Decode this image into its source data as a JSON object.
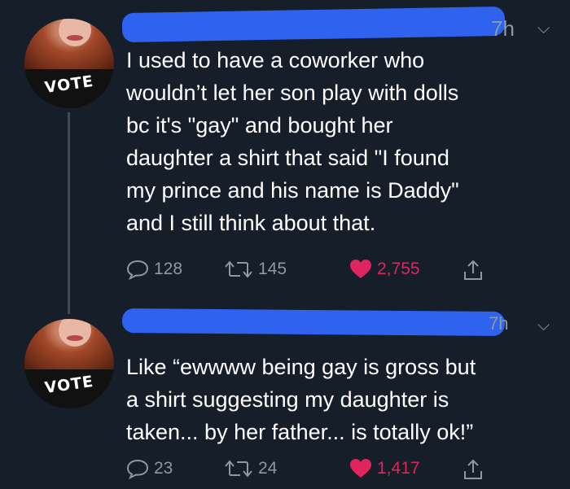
{
  "colors": {
    "background": "#151e29",
    "text": "#ffffff",
    "muted": "#8b98a5",
    "like": "#e0245e",
    "redaction": "#2f62ee"
  },
  "tweets": [
    {
      "time": "7h",
      "avatar_text": "VOTE",
      "text": "I used to have a coworker who\nwouldn’t let her son play with dolls\nbc it's \"gay\" and bought her\ndaughter a shirt that said \"I found\nmy prince and his name is Daddy\"\nand I still think about that.",
      "replies": "128",
      "retweets": "145",
      "likes": "2,755"
    },
    {
      "time": "7h",
      "avatar_text": "VOTE",
      "text": "Like “ewwww being gay is gross but\na shirt suggesting my daughter is\ntaken... by her father... is totally ok!”",
      "replies": "23",
      "retweets": "24",
      "likes": "1,417"
    }
  ]
}
